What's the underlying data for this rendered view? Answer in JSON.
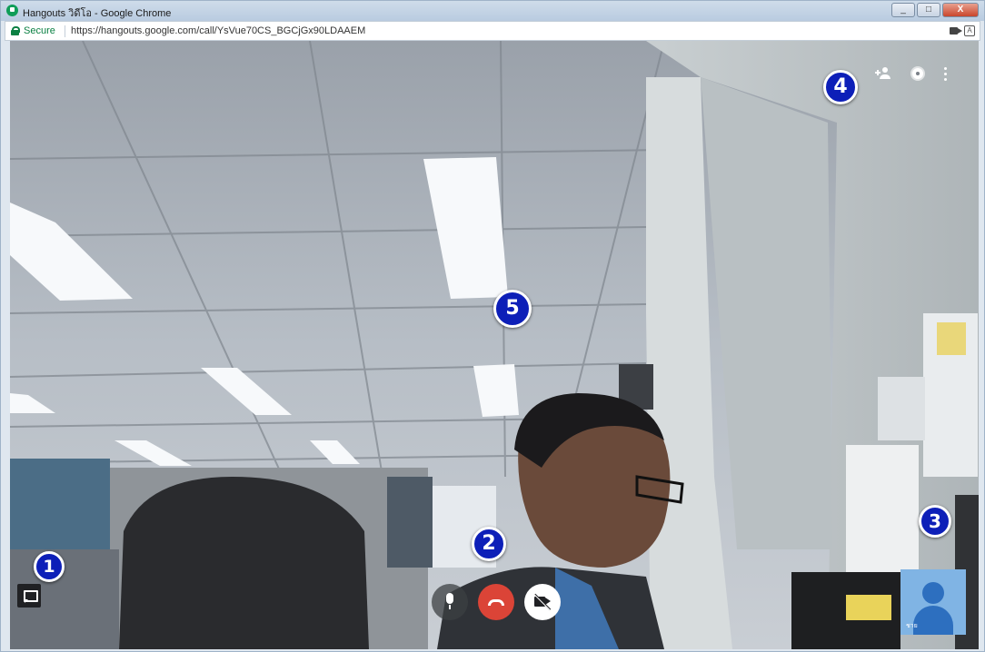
{
  "window": {
    "title": "Hangouts วิดีโอ - Google Chrome",
    "controls": {
      "minimize": "_",
      "maximize": "□",
      "close": "X"
    }
  },
  "addressbar": {
    "secure_label": "Secure",
    "url": "https://hangouts.google.com/call/YsVue70CS_BGCjGx90LDAAEM",
    "translate_glyph": "A"
  },
  "call": {
    "self_name": "ชาย",
    "controls": {
      "chat": "chat-icon",
      "mic": "mic-icon",
      "hangup": "phone-icon",
      "video": "video-off-icon"
    },
    "top_icons": [
      "add-person-icon",
      "gear-icon",
      "more-vert-icon"
    ]
  },
  "annotations": [
    "1",
    "2",
    "3",
    "4",
    "5"
  ],
  "colors": {
    "hangup": "#db4437",
    "secure": "#0b8043",
    "badge": "#0d1fb8",
    "self_tile": "#80b4e4"
  }
}
